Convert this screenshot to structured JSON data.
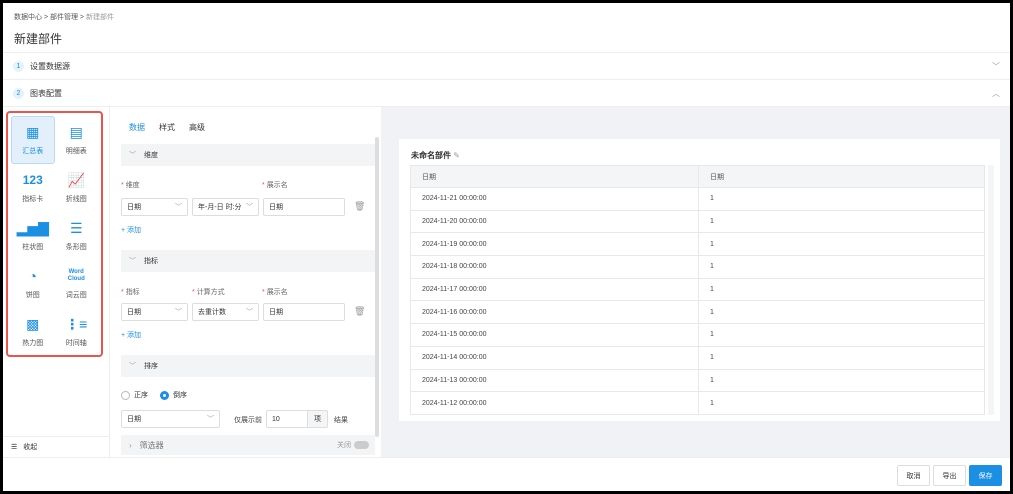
{
  "breadcrumb": [
    "数据中心",
    "部件管理",
    "新建部件"
  ],
  "title": "新建部件",
  "steps": [
    {
      "num": "1",
      "label": "设置数据源"
    },
    {
      "num": "2",
      "label": "图表配置"
    }
  ],
  "chart_types": [
    {
      "label": "汇总表",
      "icon": "summary-table-icon"
    },
    {
      "label": "明细表",
      "icon": "detail-table-icon"
    },
    {
      "label": "指标卡",
      "icon": "metric-card-icon",
      "glyph": "123"
    },
    {
      "label": "折线图",
      "icon": "line-chart-icon"
    },
    {
      "label": "柱状图",
      "icon": "column-chart-icon"
    },
    {
      "label": "条形图",
      "icon": "bar-chart-icon"
    },
    {
      "label": "饼图",
      "icon": "pie-chart-icon"
    },
    {
      "label": "词云图",
      "icon": "word-cloud-icon",
      "glyph": "Word Cloud"
    },
    {
      "label": "热力图",
      "icon": "heatmap-icon"
    },
    {
      "label": "时间轴",
      "icon": "timeline-icon"
    }
  ],
  "collapse": "收起",
  "tabs": [
    "数据",
    "样式",
    "高级"
  ],
  "dimension": {
    "section": "维度",
    "label_dim": "维度",
    "label_name": "展示名",
    "field": "日期",
    "format": "年-月-日 时:分",
    "display": "日期",
    "add": "添加"
  },
  "metric": {
    "section": "指标",
    "label_metric": "指标",
    "label_calc": "计算方式",
    "label_name": "展示名",
    "field": "日期",
    "calc": "去重计数",
    "display": "日期",
    "add": "添加"
  },
  "sort": {
    "section": "排序",
    "asc": "正序",
    "desc": "倒序",
    "field": "日期",
    "show_prefix": "仅展示前",
    "count": "10",
    "unit": "项",
    "suffix": "结果"
  },
  "filter": {
    "section": "筛选器",
    "toggle": "关闭"
  },
  "preview": {
    "title": "未命名部件",
    "headers": [
      "日期",
      "日期"
    ],
    "rows": [
      [
        "2024-11-21 00:00:00",
        "1"
      ],
      [
        "2024-11-20 00:00:00",
        "1"
      ],
      [
        "2024-11-19 00:00:00",
        "1"
      ],
      [
        "2024-11-18 00:00:00",
        "1"
      ],
      [
        "2024-11-17 00:00:00",
        "1"
      ],
      [
        "2024-11-16 00:00:00",
        "1"
      ],
      [
        "2024-11-15 00:00:00",
        "1"
      ],
      [
        "2024-11-14 00:00:00",
        "1"
      ],
      [
        "2024-11-13 00:00:00",
        "1"
      ],
      [
        "2024-11-12 00:00:00",
        "1"
      ]
    ]
  },
  "footer": {
    "cancel": "取消",
    "export": "导出",
    "save": "保存"
  }
}
